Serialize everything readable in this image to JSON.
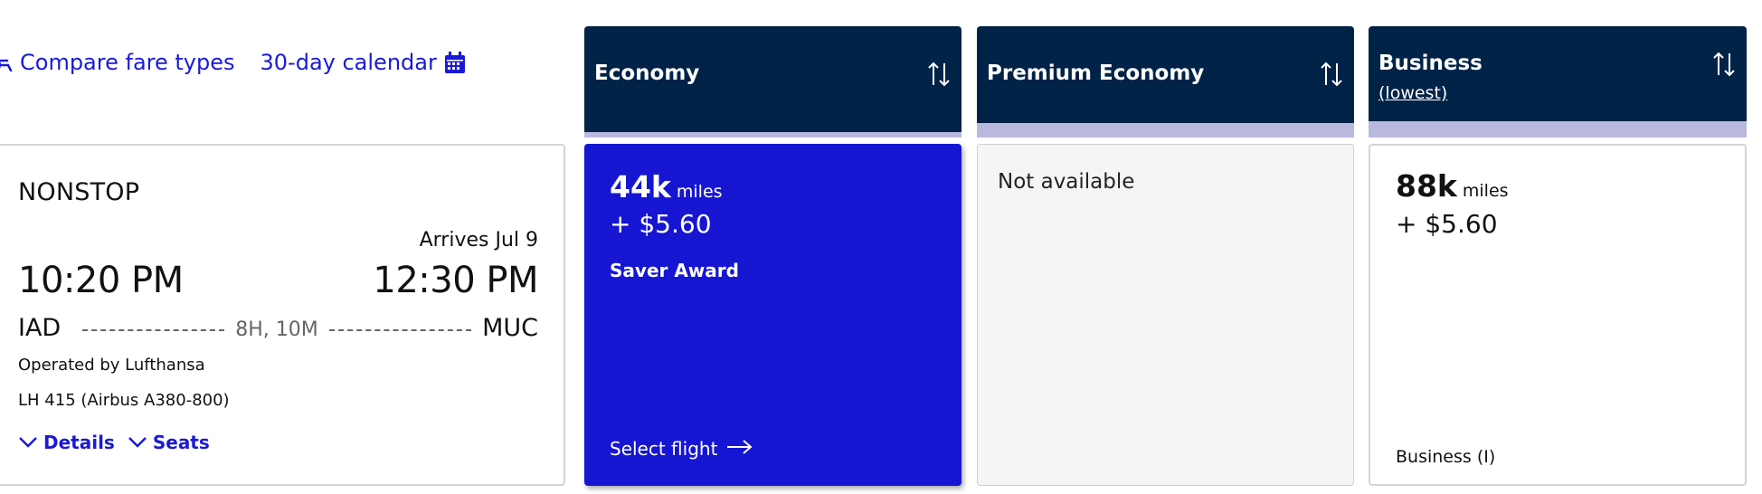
{
  "top_links": {
    "compare_label": "Compare fare types",
    "calendar_label": "30-day calendar",
    "compare_icon": "seat-icon",
    "calendar_icon": "calendar-icon"
  },
  "flight": {
    "stops": "NONSTOP",
    "arrives": "Arrives Jul 9",
    "depart_time": "10:20 PM",
    "arrive_time": "12:30 PM",
    "origin": "IAD",
    "destination": "MUC",
    "duration": "8H, 10M",
    "operator": "Operated by Lufthansa",
    "aircraft": "LH 415 (Airbus A380-800)",
    "details_label": "Details",
    "seats_label": "Seats"
  },
  "columns": [
    {
      "title": "Economy",
      "subtitle": ""
    },
    {
      "title": "Premium Economy",
      "subtitle": ""
    },
    {
      "title": "Business",
      "subtitle": "(lowest)"
    }
  ],
  "fares": {
    "economy": {
      "miles": "44k",
      "miles_unit": "miles",
      "price": "+ $5.60",
      "award": "Saver Award",
      "select_label": "Select flight"
    },
    "premium": {
      "status": "Not available"
    },
    "business": {
      "miles": "88k",
      "miles_unit": "miles",
      "price": "+ $5.60",
      "cabin": "Business (I)"
    }
  },
  "colors": {
    "header_navy": "#012347",
    "link_blue": "#1a1ad6",
    "economy_fill": "#1616d2",
    "header_accent": "#b9b9df",
    "unavailable_bg": "#f5f5f5"
  }
}
